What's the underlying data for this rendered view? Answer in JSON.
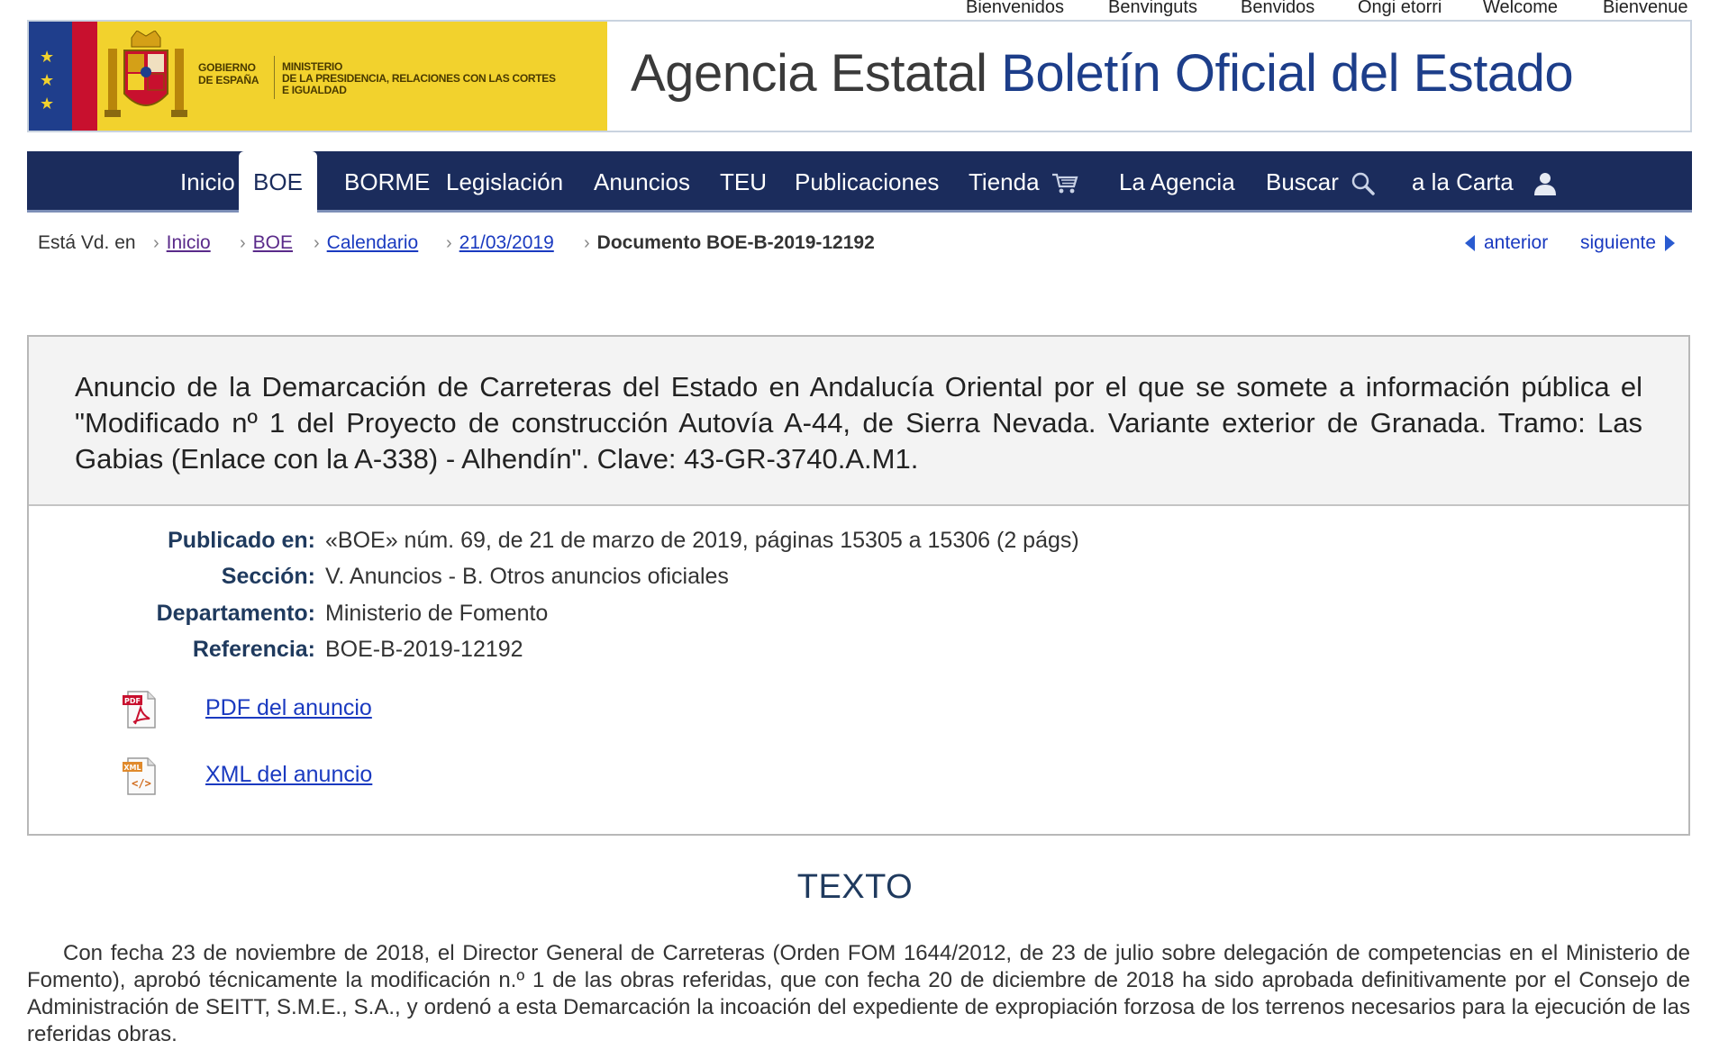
{
  "languages": [
    "Bienvenidos",
    "Benvinguts",
    "Benvidos",
    "Ongi etorri",
    "Welcome",
    "Bienvenue"
  ],
  "header": {
    "gov_name_line1": "Gobierno",
    "gov_name_line2": "de España",
    "ministry_line1": "Ministerio",
    "ministry_line2": "de la Presidencia, Relaciones con las Cortes",
    "ministry_line3": "e Igualdad",
    "agency_prefix": "Agencia Estatal",
    "agency_name": "Boletín Oficial del Estado",
    "colors": {
      "flag_blue": "#1f3e8c",
      "gov_yellow": "#f2d22d",
      "title_blue": "#1d3e8a"
    }
  },
  "nav": {
    "items": [
      {
        "label": "Inicio",
        "active": false
      },
      {
        "label": "BOE",
        "active": true
      },
      {
        "label": "BORME",
        "active": false
      },
      {
        "label": "Legislación",
        "active": false
      },
      {
        "label": "Anuncios",
        "active": false
      },
      {
        "label": "TEU",
        "active": false
      },
      {
        "label": "Publicaciones",
        "active": false
      },
      {
        "label": "Tienda",
        "active": false,
        "icon": "cart-icon"
      },
      {
        "label": "La Agencia",
        "active": false
      },
      {
        "label": "Buscar",
        "active": false,
        "icon": "search-icon"
      },
      {
        "label": "a la Carta",
        "active": false,
        "icon": "user-icon"
      }
    ],
    "colors": {
      "background": "#1b2c5c"
    }
  },
  "breadcrumb": {
    "prefix": "Está Vd. en",
    "items": [
      "Inicio",
      "BOE",
      "Calendario",
      "21/03/2019"
    ],
    "current": "Documento BOE-B-2019-12192"
  },
  "pager": {
    "previous": "anterior",
    "next": "siguiente"
  },
  "document": {
    "title": "Anuncio de la Demarcación de Carreteras del Estado en Andalucía Oriental por el que se somete a información pública el \"Modificado nº 1 del Proyecto de construcción Autovía A-44, de Sierra Nevada. Variante exterior de Granada. Tramo: Las Gabias (Enlace con la A-338) - Alhendín\". Clave: 43-GR-3740.A.M1.",
    "metadata": [
      {
        "label": "Publicado en:",
        "value": "«BOE» núm. 69, de 21 de marzo de 2019, páginas 15305 a 15306 (2 págs)"
      },
      {
        "label": "Sección:",
        "value": "V. Anuncios - B. Otros anuncios oficiales"
      },
      {
        "label": "Departamento:",
        "value": "Ministerio de Fomento"
      },
      {
        "label": "Referencia:",
        "value": "BOE-B-2019-12192"
      }
    ],
    "downloads": [
      {
        "label": "PDF del anuncio",
        "icon": "pdf-file-icon"
      },
      {
        "label": "XML del anuncio",
        "icon": "xml-file-icon"
      }
    ]
  },
  "texto": {
    "heading": "TEXTO",
    "paragraph": "Con fecha 23 de noviembre de 2018, el Director General de Carreteras (Orden FOM 1644/2012, de 23 de julio sobre delegación de competencias en el Ministerio de Fomento), aprobó técnicamente la modificación n.º 1 de las obras referidas, que con fecha 20 de diciembre de 2018 ha sido aprobada definitivamente por el Consejo de Administración de SEITT, S.M.E., S.A., y ordenó a esta Demarcación la incoación del expediente de expropiación forzosa de los terrenos necesarios para la ejecución de las referidas obras."
  }
}
